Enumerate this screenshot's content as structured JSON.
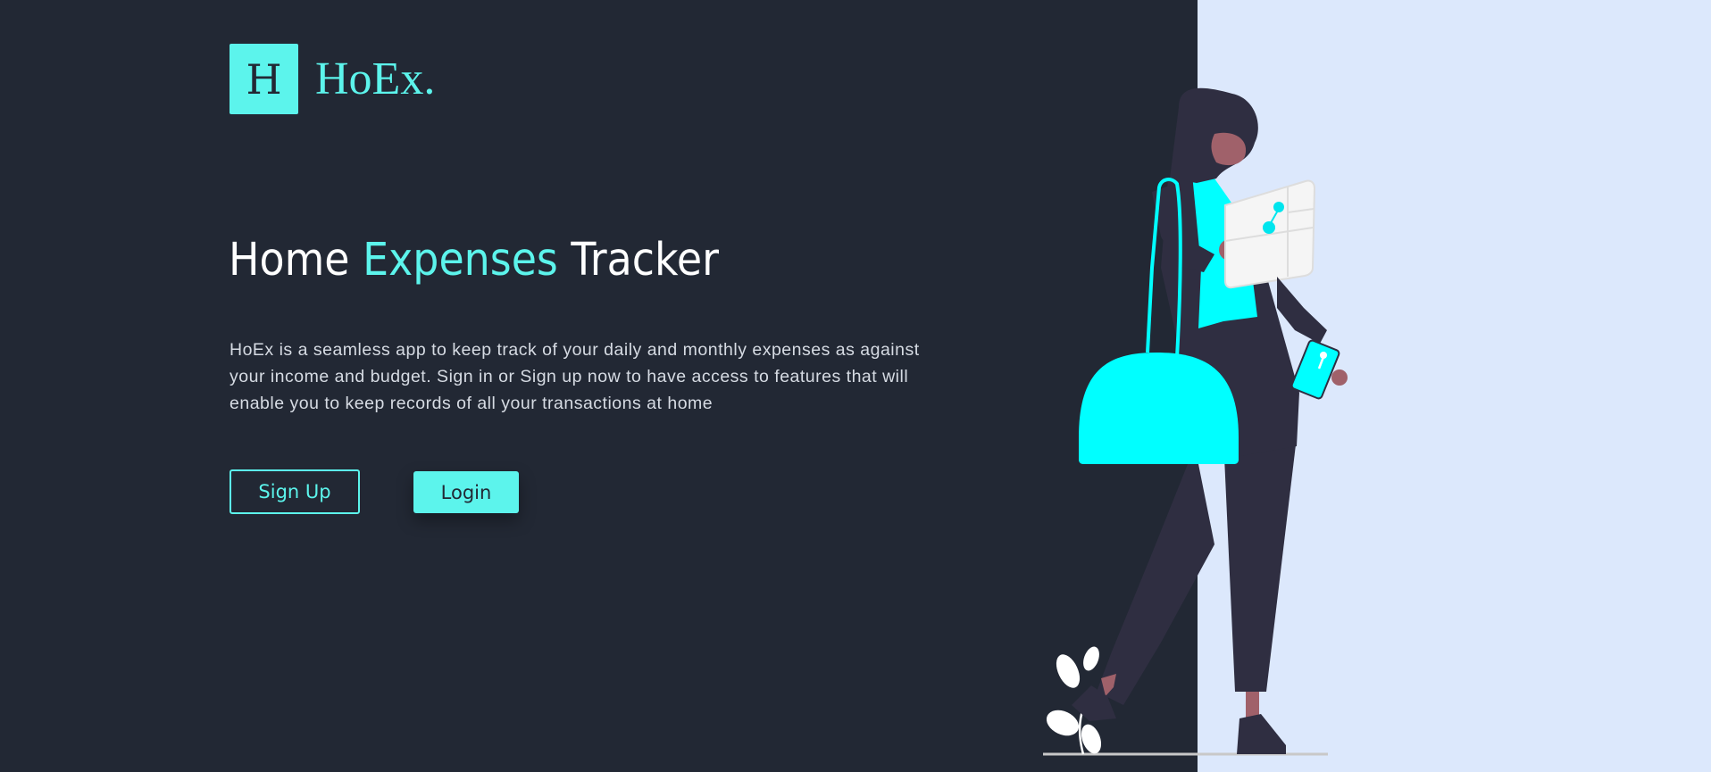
{
  "logo": {
    "letter": "H",
    "name": "HoEx."
  },
  "hero": {
    "title_part1": "Home ",
    "title_accent": "Expenses",
    "title_part2": " Tracker",
    "description": "HoEx is a seamless app to keep track of your daily and monthly expenses as against your income and budget. Sign in or Sign up now to have access to features that will enable you to keep records of all your transactions at home"
  },
  "actions": {
    "signup_label": "Sign Up",
    "login_label": "Login"
  },
  "colors": {
    "background_dark": "#222834",
    "background_light": "#dce8fc",
    "accent": "#5cf4ec",
    "illustration_cyan": "#00ffff",
    "figure_dark": "#2f2e41",
    "skin": "#a0616a"
  }
}
